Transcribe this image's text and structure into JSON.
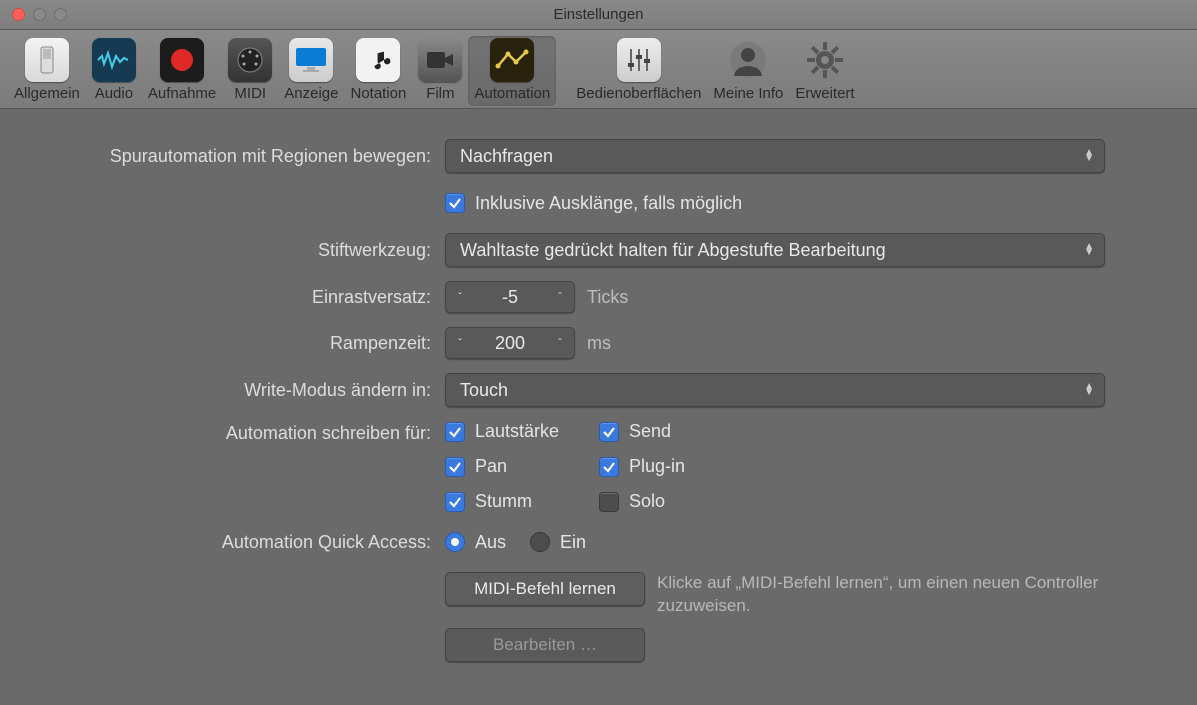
{
  "window": {
    "title": "Einstellungen"
  },
  "toolbar": {
    "items": [
      {
        "id": "general",
        "label": "Allgemein"
      },
      {
        "id": "audio",
        "label": "Audio"
      },
      {
        "id": "record",
        "label": "Aufnahme"
      },
      {
        "id": "midi",
        "label": "MIDI"
      },
      {
        "id": "display",
        "label": "Anzeige"
      },
      {
        "id": "notation",
        "label": "Notation"
      },
      {
        "id": "film",
        "label": "Film"
      },
      {
        "id": "automation",
        "label": "Automation"
      },
      {
        "id": "surfaces",
        "label": "Bedienoberflächen"
      },
      {
        "id": "myinfo",
        "label": "Meine Info"
      },
      {
        "id": "advanced",
        "label": "Erweitert"
      }
    ],
    "selected": "automation"
  },
  "labels": {
    "move_with_regions": "Spurautomation mit Regionen bewegen:",
    "include_tails": "Inklusive Ausklänge, falls möglich",
    "pencil_tool": "Stiftwerkzeug:",
    "snap_offset": "Einrastversatz:",
    "ramp_time": "Rampenzeit:",
    "write_mode_change": "Write-Modus ändern in:",
    "write_automation_for": "Automation schreiben für:",
    "quick_access": "Automation Quick Access:",
    "ticks": "Ticks",
    "ms": "ms"
  },
  "values": {
    "move_with_regions": "Nachfragen",
    "include_tails_checked": true,
    "pencil_tool": "Wahltaste gedrückt halten für Abgestufte Bearbeitung",
    "snap_offset": "-5",
    "ramp_time": "200",
    "write_mode_change": "Touch",
    "write_for": {
      "volume": {
        "label": "Lautstärke",
        "checked": true
      },
      "send": {
        "label": "Send",
        "checked": true
      },
      "pan": {
        "label": "Pan",
        "checked": true
      },
      "plugin": {
        "label": "Plug-in",
        "checked": true
      },
      "mute": {
        "label": "Stumm",
        "checked": true
      },
      "solo": {
        "label": "Solo",
        "checked": false
      }
    },
    "quick_access": {
      "off": {
        "label": "Aus",
        "selected": true
      },
      "on": {
        "label": "Ein",
        "selected": false
      }
    }
  },
  "buttons": {
    "learn_midi": "MIDI-Befehl lernen",
    "edit": "Bearbeiten …"
  },
  "hints": {
    "learn_midi": "Klicke auf „MIDI-Befehl lernen“, um einen neuen Controller zuzuweisen."
  }
}
